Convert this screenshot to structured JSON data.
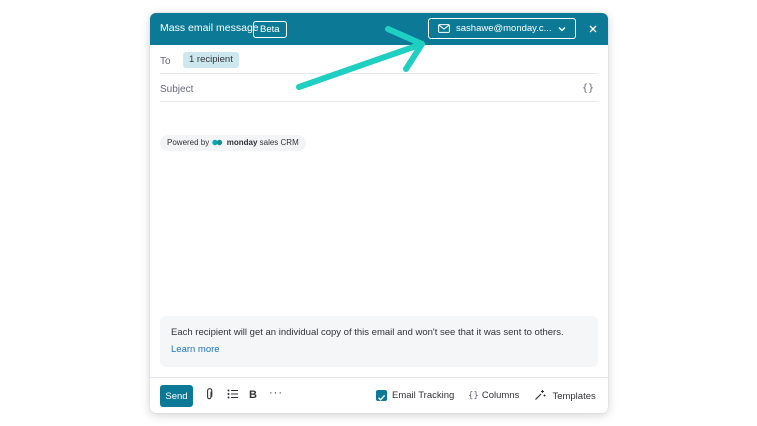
{
  "header": {
    "title": "Mass email message",
    "badge": "Beta",
    "sender": "sashawe@monday.c...",
    "close_symbol": "×"
  },
  "to_field": {
    "label": "To",
    "chip": "1 recipient"
  },
  "subject_field": {
    "placeholder": "Subject",
    "value": "",
    "insert_symbol": "{}"
  },
  "powered_by": {
    "prefix": "Powered by",
    "brand": "monday",
    "suffix": "sales CRM"
  },
  "info": {
    "text": "Each recipient will get an individual copy of this email and won't see that it was sent to others.",
    "link": "Learn more"
  },
  "footer": {
    "send": "Send",
    "bold": "B",
    "more": "···",
    "email_tracking": {
      "label": "Email Tracking",
      "checked": true
    },
    "columns": {
      "symbol": "{}",
      "label": "Columns"
    },
    "templates": "Templates"
  },
  "icons": [
    "mail-icon",
    "chevron-down-icon",
    "close-icon",
    "paperclip-icon",
    "bullet-list-icon",
    "check-icon",
    "magic-wand-icon",
    "monday-logo-icon",
    "arrow-annotation"
  ],
  "colors": {
    "header_bg": "#0c7a96",
    "chip_bg": "#cde7ee",
    "link": "#1f76c2",
    "annotation_arrow": "#1fcfc2"
  }
}
